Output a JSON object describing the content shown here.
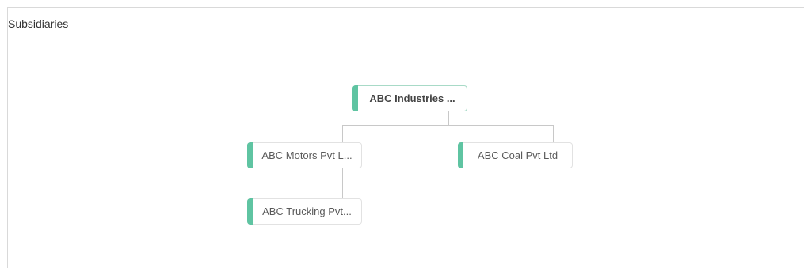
{
  "panel": {
    "title": "Subsidiaries"
  },
  "org_chart": {
    "root": {
      "label": "ABC Industries ..."
    },
    "children": [
      {
        "label": "ABC Motors Pvt L...",
        "children": [
          {
            "label": "ABC Trucking Pvt..."
          }
        ]
      },
      {
        "label": "ABC Coal Pvt Ltd"
      }
    ]
  },
  "colors": {
    "node_accent": "#5fc4a2",
    "root_border": "#a8dac7",
    "connector": "#c8c8c8"
  }
}
